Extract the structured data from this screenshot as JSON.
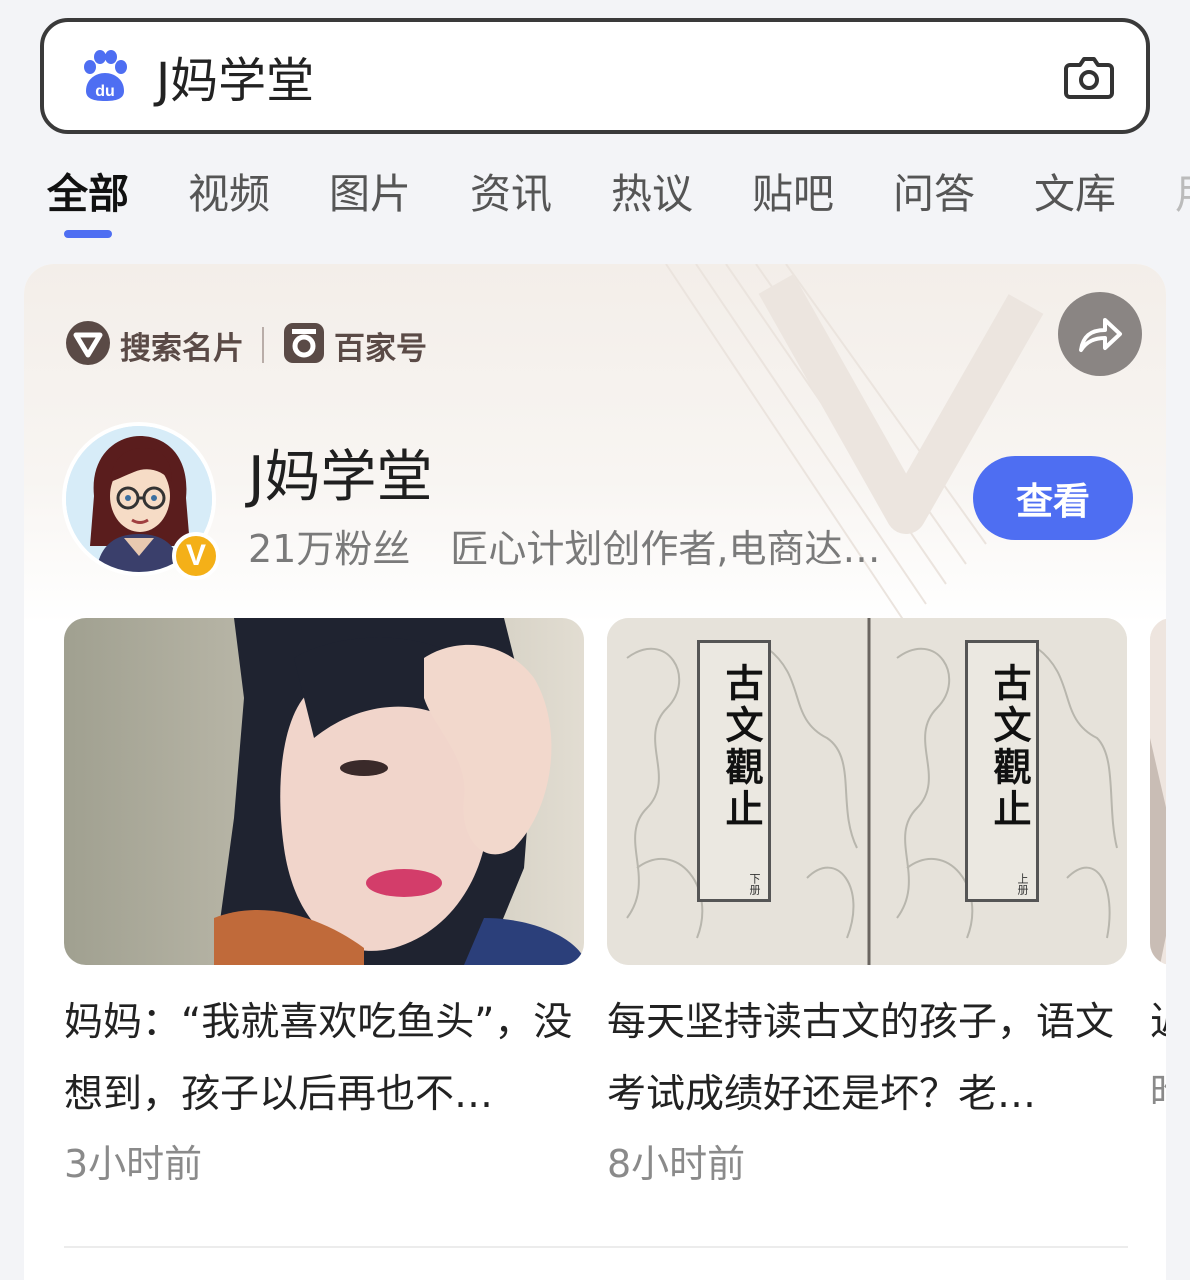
{
  "search": {
    "query": "J妈学堂"
  },
  "tabs": [
    {
      "label": "全部",
      "active": true
    },
    {
      "label": "视频"
    },
    {
      "label": "图片"
    },
    {
      "label": "资讯"
    },
    {
      "label": "热议"
    },
    {
      "label": "贴吧"
    },
    {
      "label": "问答"
    },
    {
      "label": "文库"
    },
    {
      "label": "用"
    }
  ],
  "card": {
    "brand_primary": "搜索名片",
    "brand_secondary": "百家号",
    "profile": {
      "name": "J妈学堂",
      "followers": "21万粉丝",
      "description": "匠心计划创作者,电商达…",
      "badge": "V"
    },
    "view_button": "查看",
    "posts": [
      {
        "title": "妈妈：“我就喜欢吃鱼头”，没想到，孩子以后再也不…",
        "time": "3小时前"
      },
      {
        "title": "每天坚持读古文的孩子，语文考试成绩好还是坏？老…",
        "time": "8小时前",
        "book_title": "古文觀止",
        "book_volume_left": "下册",
        "book_volume_right": "上册"
      },
      {
        "title": "近…",
        "time": "昨"
      }
    ]
  },
  "colors": {
    "accent": "#4e6ef2",
    "badge": "#f4b018"
  }
}
